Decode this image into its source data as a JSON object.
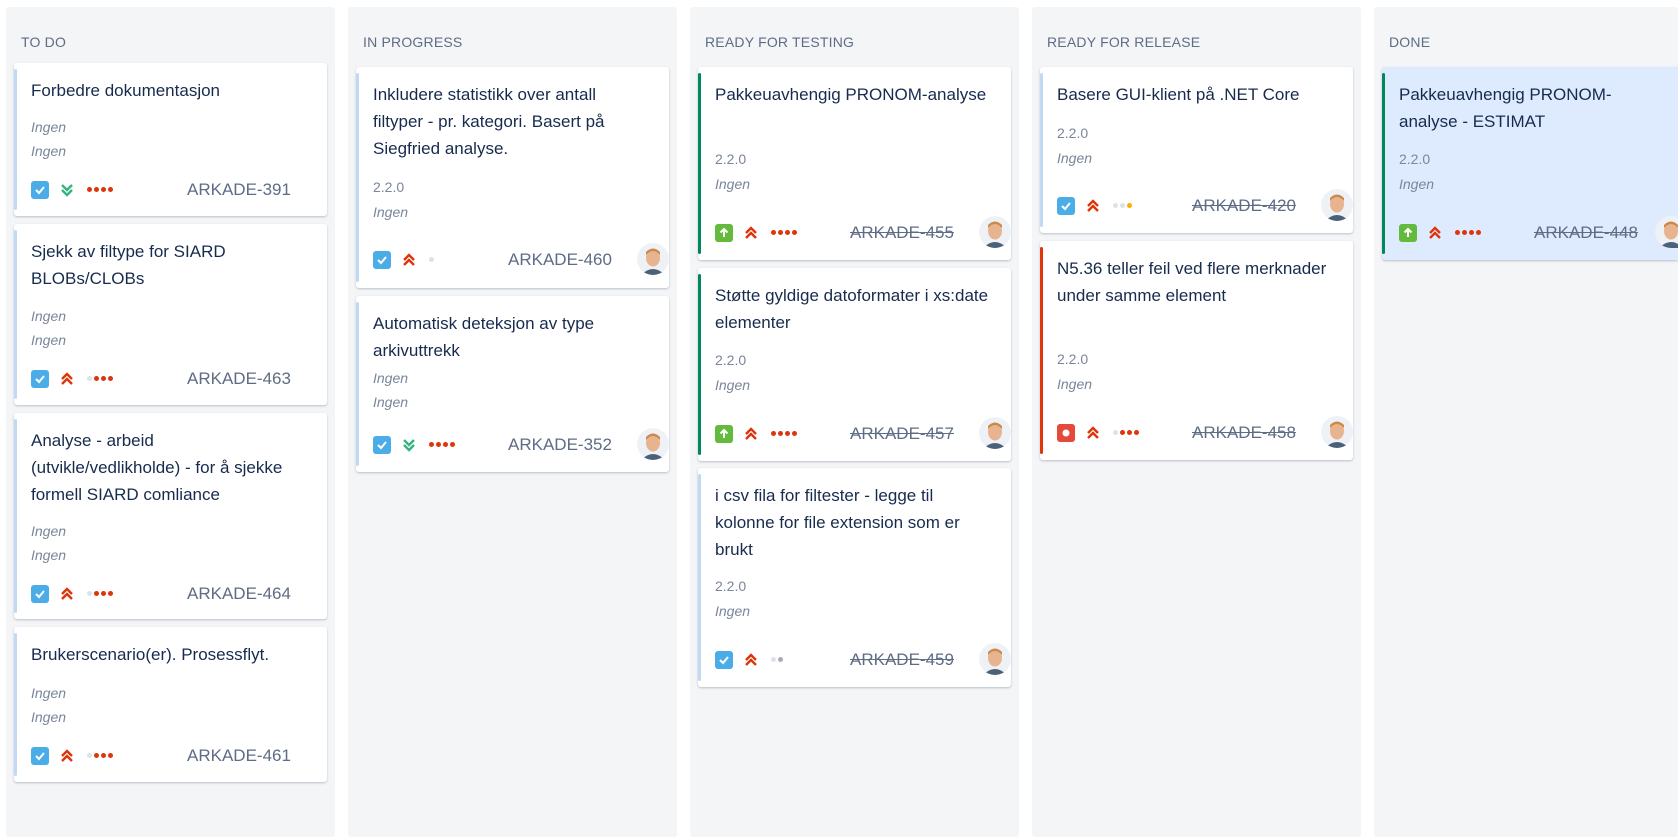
{
  "columns": [
    {
      "title": "TO DO"
    },
    {
      "title": "IN PROGRESS"
    },
    {
      "title": "READY FOR TESTING"
    },
    {
      "title": "READY FOR RELEASE"
    },
    {
      "title": "DONE"
    }
  ],
  "cards": {
    "c391": {
      "title": "Forbedre dokumentasjon",
      "meta1": "Ingen",
      "meta2": "Ingen",
      "key": "ARKADE-391"
    },
    "c463": {
      "title": "Sjekk av filtype for SIARD BLOBs/CLOBs",
      "meta1": "Ingen",
      "meta2": "Ingen",
      "key": "ARKADE-463"
    },
    "c464": {
      "title": "Analyse - arbeid (utvikle/vedlikholde) - for å sjekke formell SIARD comliance",
      "meta1": "Ingen",
      "meta2": "Ingen",
      "key": "ARKADE-464"
    },
    "c461": {
      "title": "Brukerscenario(er). Prosessflyt.",
      "meta1": "Ingen",
      "meta2": "Ingen",
      "key": "ARKADE-461"
    },
    "c460": {
      "title": "Inkludere statistikk over antall filtyper - pr. kategori. Basert på Siegfried analyse.",
      "meta1": "2.2.0",
      "meta2": "Ingen",
      "key": "ARKADE-460"
    },
    "c352": {
      "title": "Automatisk deteksjon av type arkivuttrekk",
      "meta1": "Ingen",
      "meta2": "Ingen",
      "key": "ARKADE-352"
    },
    "c455": {
      "title": "Pakkeuavhengig PRONOM-analyse",
      "meta1": "2.2.0",
      "meta2": "Ingen",
      "key": "ARKADE-455"
    },
    "c457": {
      "title": "Støtte gyldige datoformater i xs:date elementer",
      "meta1": "2.2.0",
      "meta2": "Ingen",
      "key": "ARKADE-457"
    },
    "c459": {
      "title": "i csv fila for filtester - legge til kolonne for file extension som er brukt",
      "meta1": "2.2.0",
      "meta2": "Ingen",
      "key": "ARKADE-459"
    },
    "c420": {
      "title": "Basere GUI-klient på .NET Core",
      "meta1": "2.2.0",
      "meta2": "Ingen",
      "key": "ARKADE-420"
    },
    "c458": {
      "title": "N5.36 teller feil ved flere merknader under samme element",
      "meta1": "2.2.0",
      "meta2": "Ingen",
      "key": "ARKADE-458"
    },
    "c448": {
      "title": "Pakkeuavhengig PRONOM-analyse - ESTIMAT",
      "meta1": "2.2.0",
      "meta2": "Ingen",
      "key": "ARKADE-448"
    }
  },
  "icons": {
    "task": "checkbox-icon",
    "story": "story-up-arrow-icon",
    "bug": "bug-icon",
    "priority_high": "priority-highest-icon",
    "priority_low": "priority-lowest-icon"
  },
  "colors": {
    "accent_blue": "#0065ff",
    "task_blue": "#4bade8",
    "story_green": "#63ba3c",
    "bug_red": "#e5493a",
    "stripe_green": "#00875a",
    "stripe_red": "#de350b",
    "stripe_lightblue": "#c1d9f3",
    "done_card_bg": "#deebff"
  }
}
